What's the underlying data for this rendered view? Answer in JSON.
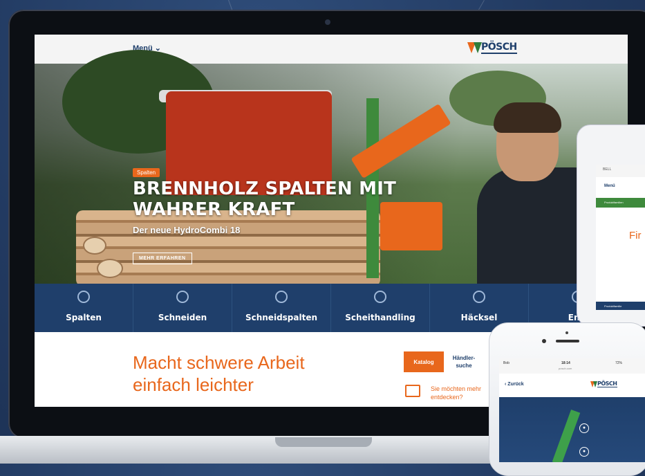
{
  "laptop": {
    "header": {
      "menu_label": "Menü",
      "menu_chevron_icon": "chevron-down-icon",
      "logo_text": "PÖSCH"
    },
    "hero": {
      "tag": "Spalten",
      "title": "BRENNHOLZ SPALTEN MIT WAHRER KRAFT",
      "subtitle": "Der neue HydroCombi 18",
      "button_label": "MEHR ERFAHREN"
    },
    "categories": [
      {
        "label": "Spalten",
        "icon": "split-icon"
      },
      {
        "label": "Schneiden",
        "icon": "saw-blade-icon"
      },
      {
        "label": "Schneidspalten",
        "icon": "cut-split-icon"
      },
      {
        "label": "Scheithandling",
        "icon": "log-handling-icon"
      },
      {
        "label": "Häcksel",
        "icon": "chipper-icon"
      },
      {
        "label": "Entr",
        "icon": "debark-icon"
      }
    ],
    "tagline": "Macht schwere Arbeit einfach leichter",
    "tabs": {
      "catalog": "Katalog",
      "dealer": "Händler-suche"
    },
    "discover_text": "Sie möchten mehr entdecken?"
  },
  "phone1": {
    "status": "BELL",
    "menu_label": "Menü",
    "green_bar": "Produktfamilien",
    "orange_text": "Fir",
    "blue_bar": "Produktfamilie"
  },
  "phone2": {
    "carrier": "Bob",
    "time": "18:14",
    "url": "posch.com",
    "battery": "72%",
    "back_label": "Zurück",
    "logo_text": "PÖSCH"
  },
  "colors": {
    "brand_blue": "#1f3f6b",
    "brand_orange": "#e8671c",
    "brand_green": "#3e8a3c"
  }
}
